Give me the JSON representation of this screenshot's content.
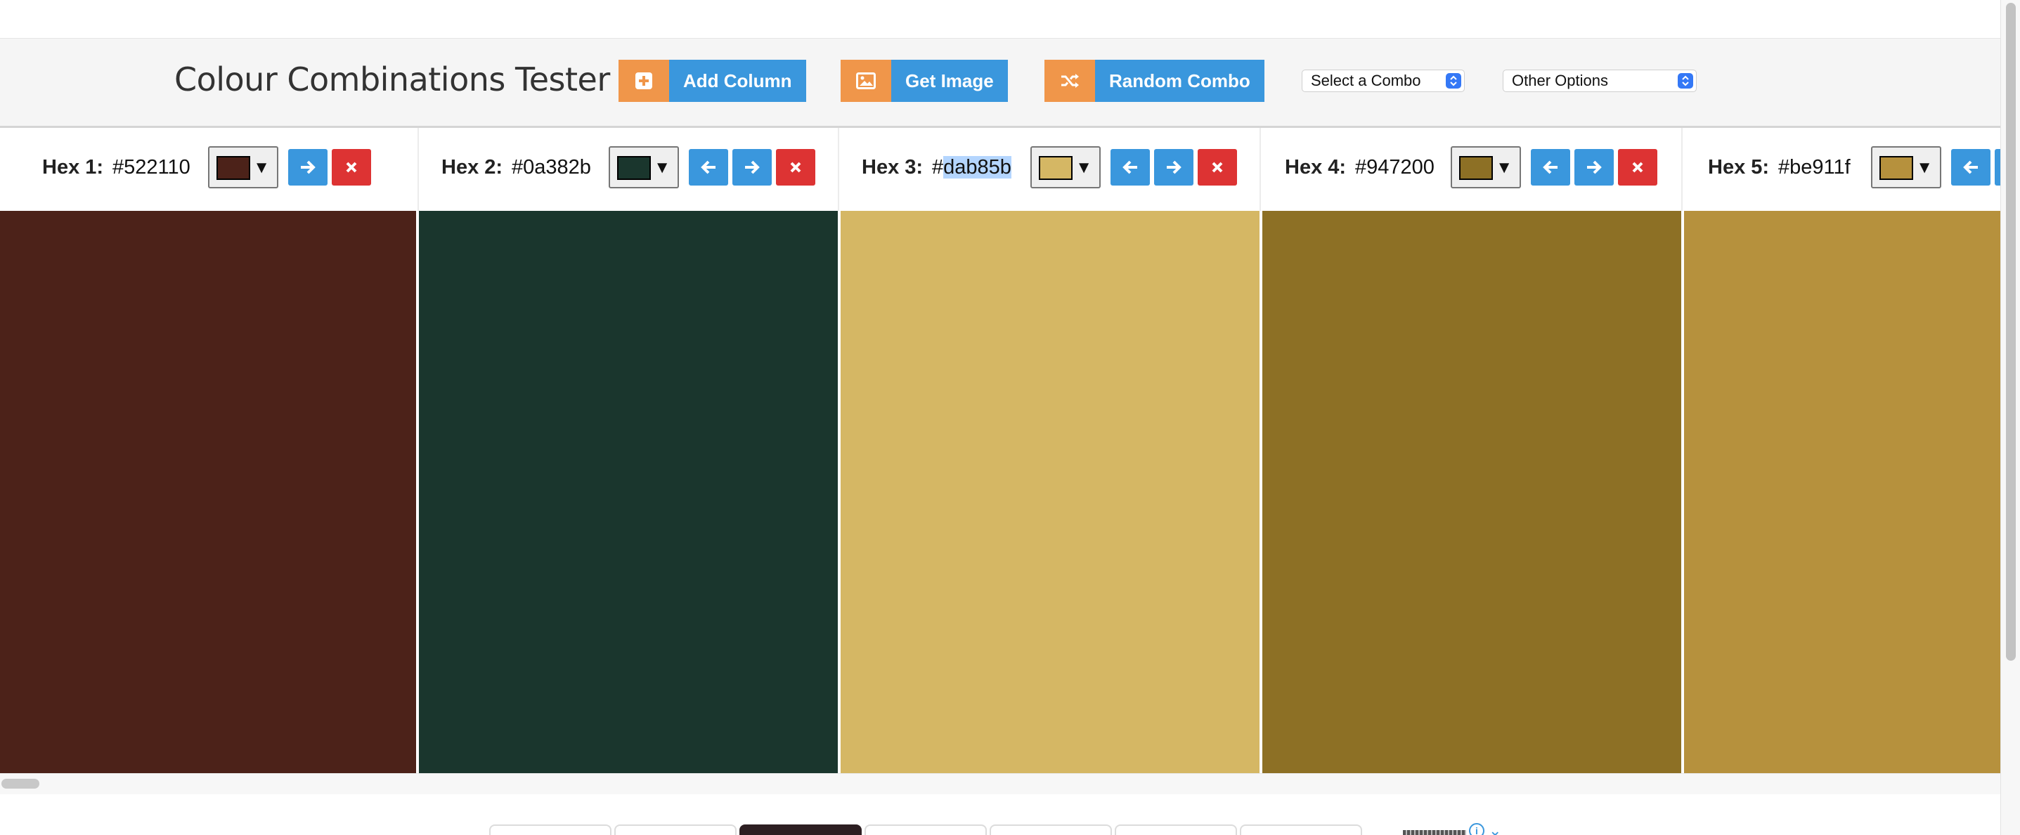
{
  "header": {
    "title": "Colour Combinations Tester",
    "buttons": [
      {
        "label": "Add Column",
        "icon": "plus-square-icon"
      },
      {
        "label": "Get Image",
        "icon": "image-icon"
      },
      {
        "label": "Random Combo",
        "icon": "shuffle-icon"
      }
    ],
    "selects": [
      {
        "value": "Select a Combo"
      },
      {
        "value": "Other Options"
      }
    ]
  },
  "columns": [
    {
      "label": "Hex 1:",
      "value": "#522110",
      "color": "#4c2219"
    },
    {
      "label": "Hex 2:",
      "value": "#0a382b",
      "color": "#1a362d"
    },
    {
      "label": "Hex 3:",
      "prefix": "#",
      "value_selected": "dab85b",
      "color": "#d5b764"
    },
    {
      "label": "Hex 4:",
      "value": "#947200",
      "color": "#8d7025"
    },
    {
      "label": "Hex 5:",
      "value": "#be911f",
      "color": "#b6913d"
    }
  ],
  "colors": {
    "accent_blue": "#3a97dd",
    "accent_orange": "#f0964a",
    "danger_red": "#dd3333"
  }
}
